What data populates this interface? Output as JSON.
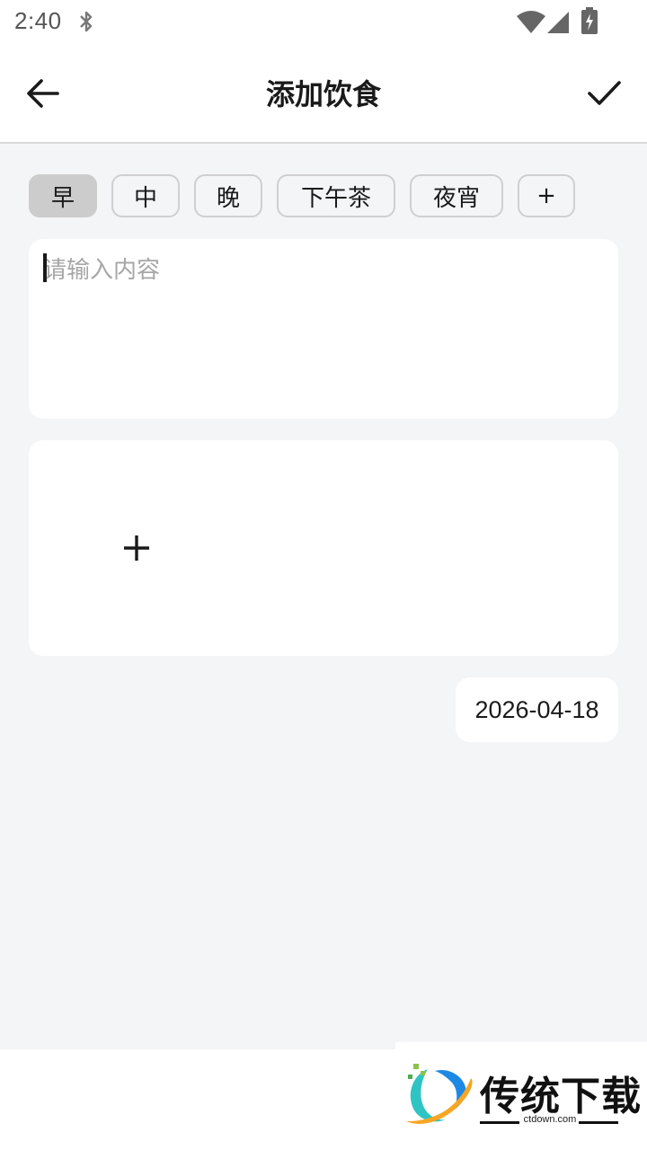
{
  "status_bar": {
    "time": "2:40",
    "icons": [
      "bluetooth-icon",
      "wifi-icon",
      "signal-icon",
      "battery-charging-icon"
    ]
  },
  "app_bar": {
    "title": "添加饮食",
    "back_icon": "arrow-left-icon",
    "confirm_icon": "check-icon"
  },
  "meal_chips": [
    {
      "label": "早",
      "selected": true
    },
    {
      "label": "中",
      "selected": false
    },
    {
      "label": "晚",
      "selected": false
    },
    {
      "label": "下午茶",
      "selected": false
    },
    {
      "label": "夜宵",
      "selected": false
    },
    {
      "label": "+",
      "selected": false
    }
  ],
  "content": {
    "value": "",
    "placeholder": "请输入内容"
  },
  "photo": {
    "add_icon": "plus-icon"
  },
  "date": {
    "value": "2026-04-18"
  },
  "watermark": {
    "title": "传统下载",
    "url": "ctdown.com"
  },
  "colors": {
    "background": "#f4f5f7",
    "card": "#ffffff",
    "chip_selected": "#cccccc",
    "chip_border": "#cfcfcf",
    "placeholder": "#a6a6a6",
    "text": "#1a1a1a"
  }
}
